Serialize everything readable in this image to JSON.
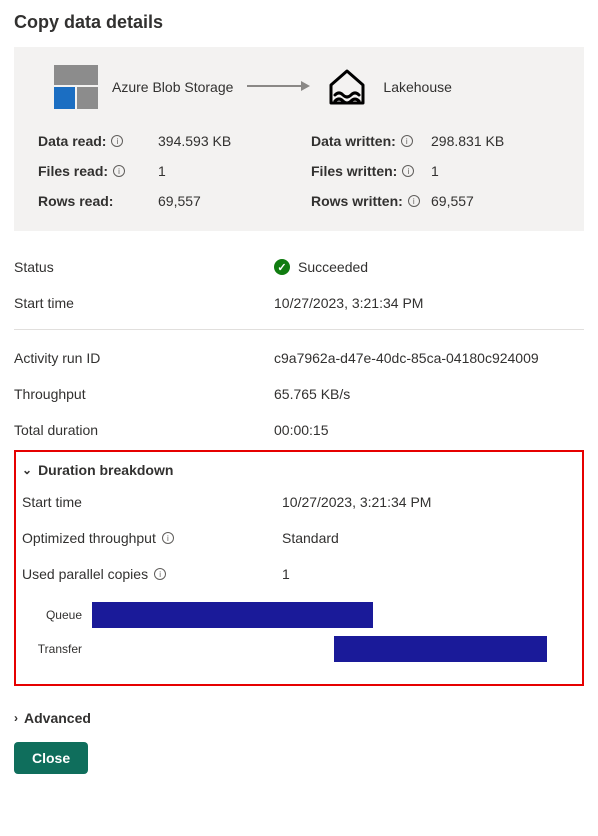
{
  "title": "Copy data details",
  "source": {
    "label": "Azure Blob Storage",
    "icon": "azure-blob"
  },
  "sink": {
    "label": "Lakehouse",
    "icon": "lakehouse"
  },
  "stats": {
    "data_read": {
      "label": "Data read:",
      "value": "394.593 KB",
      "info": true
    },
    "data_written": {
      "label": "Data written:",
      "value": "298.831 KB",
      "info": true
    },
    "files_read": {
      "label": "Files read:",
      "value": "1",
      "info": true
    },
    "files_written": {
      "label": "Files written:",
      "value": "1",
      "info": true
    },
    "rows_read": {
      "label": "Rows read:",
      "value": "69,557",
      "info": false
    },
    "rows_written": {
      "label": "Rows written:",
      "value": "69,557",
      "info": true
    }
  },
  "status": {
    "label": "Status",
    "value": "Succeeded"
  },
  "start_time": {
    "label": "Start time",
    "value": "10/27/2023, 3:21:34 PM"
  },
  "run_id": {
    "label": "Activity run ID",
    "value": "c9a7962a-d47e-40dc-85ca-04180c924009"
  },
  "throughput": {
    "label": "Throughput",
    "value": "65.765 KB/s"
  },
  "total_dur": {
    "label": "Total duration",
    "value": "00:00:15"
  },
  "breakdown": {
    "title": "Duration breakdown",
    "start_time": {
      "label": "Start time",
      "value": "10/27/2023, 3:21:34 PM"
    },
    "opt_throughput": {
      "label": "Optimized throughput",
      "value": "Standard"
    },
    "parallel_copies": {
      "label": "Used parallel copies",
      "value": "1"
    },
    "bars": {
      "queue": {
        "label": "Queue",
        "start_pct": 0,
        "width_pct": 58
      },
      "transfer": {
        "label": "Transfer",
        "start_pct": 50,
        "width_pct": 44
      }
    }
  },
  "advanced_label": "Advanced",
  "close_label": "Close"
}
